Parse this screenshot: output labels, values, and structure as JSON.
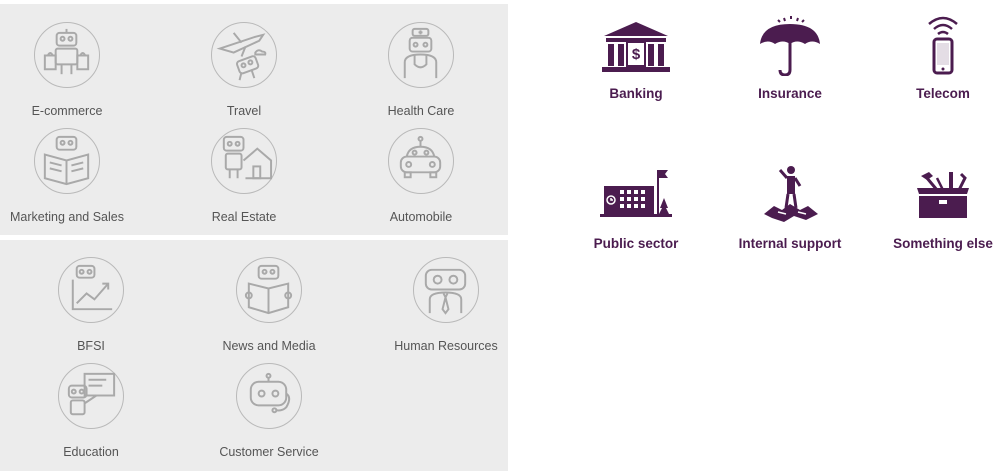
{
  "bot_categories": {
    "top": [
      {
        "label": "E-commerce",
        "icon": "shopping-bot-icon"
      },
      {
        "label": "Travel",
        "icon": "airplane-bot-icon"
      },
      {
        "label": "Health Care",
        "icon": "doctor-bot-icon"
      },
      {
        "label": "Marketing and Sales",
        "icon": "book-bot-icon"
      },
      {
        "label": "Real Estate",
        "icon": "house-bot-icon"
      },
      {
        "label": "Automobile",
        "icon": "car-icon"
      }
    ],
    "bottom": [
      {
        "label": "BFSI",
        "icon": "growth-chart-bot-icon"
      },
      {
        "label": "News and Media",
        "icon": "newspaper-bot-icon"
      },
      {
        "label": "Human Resources",
        "icon": "tie-bot-icon"
      },
      {
        "label": "Education",
        "icon": "teacher-bot-icon"
      },
      {
        "label": "Customer Service",
        "icon": "headset-bot-icon"
      }
    ]
  },
  "industries": [
    {
      "label": "Banking",
      "icon": "bank-icon"
    },
    {
      "label": "Insurance",
      "icon": "umbrella-icon"
    },
    {
      "label": "Telecom",
      "icon": "mobile-phone-icon"
    },
    {
      "label": "Public sector",
      "icon": "government-building-icon"
    },
    {
      "label": "Internal support",
      "icon": "support-person-icon"
    },
    {
      "label": "Something else",
      "icon": "toolbox-icon"
    }
  ],
  "colors": {
    "panel_bg": "#ececec",
    "circle_stroke": "#b9b9b9",
    "grey_icon": "#a9a9a9",
    "label_grey": "#555555",
    "industry_purple": "#4b1c4f"
  }
}
